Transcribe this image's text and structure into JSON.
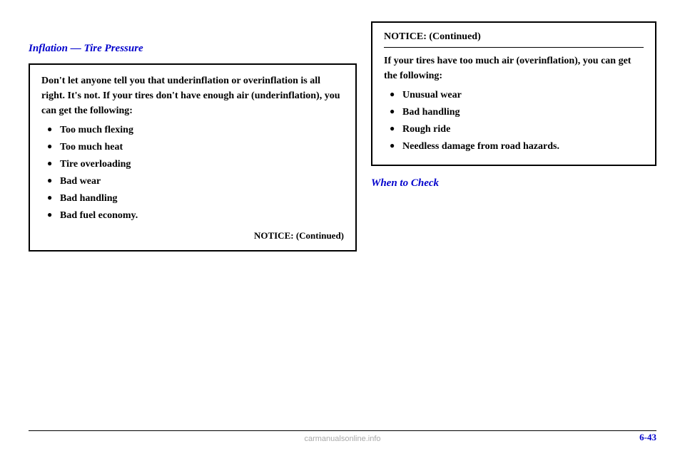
{
  "page": {
    "title": "Inflation — Tire Pressure",
    "page_number": "6-43",
    "bottom_label": "carmanualsonline.info"
  },
  "left_column": {
    "notice_box": {
      "intro_text": "Don't let anyone tell you that underinflation or overinflation is all right. It's not. If your tires don't have enough air (underinflation), you can get the following:",
      "bullets": [
        "Too much flexing",
        "Too much heat",
        "Tire overloading",
        "Bad wear",
        "Bad handling",
        "Bad fuel economy."
      ],
      "continued_label": "NOTICE: (Continued)"
    }
  },
  "right_column": {
    "notice_continued_box": {
      "title": "NOTICE: (Continued)",
      "intro_text": "If your tires have too much air (overinflation), you can get the following:",
      "bullets": [
        "Unusual wear",
        "Bad handling",
        "Rough ride",
        "Needless damage from road hazards."
      ]
    },
    "when_to_check": {
      "label": "When to Check"
    }
  }
}
